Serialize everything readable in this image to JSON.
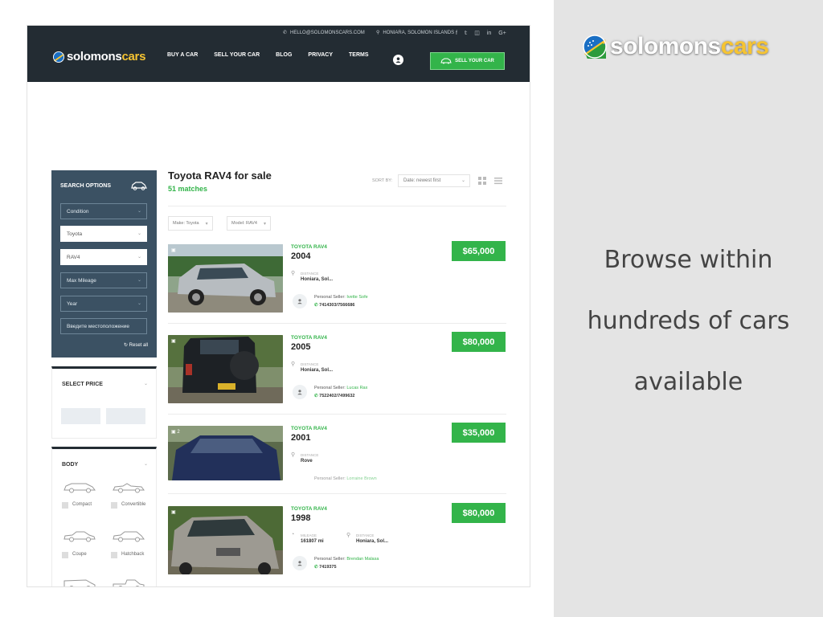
{
  "promo": {
    "brand_main": "solomons",
    "brand_accent": "cars",
    "lines": [
      "Browse within",
      "hundreds of cars",
      "available"
    ]
  },
  "topbar": {
    "email": "HELLO@SOLOMONSCARS.COM",
    "location": "HONIARA, SOLOMON ISLANDS",
    "social": [
      "f",
      "t",
      "ig",
      "in",
      "G+"
    ]
  },
  "header": {
    "brand_main": "solomons",
    "brand_accent": "cars",
    "nav": [
      "BUY A CAR",
      "SELL YOUR CAR",
      "BLOG",
      "PRIVACY",
      "TERMS"
    ],
    "sell_button": "SELL YOUR CAR"
  },
  "sidebar": {
    "search_title": "SEARCH OPTIONS",
    "filters": [
      "Condition",
      "Toyota",
      "RAV4",
      "Max Mileage",
      "Year",
      "Введите местоположение"
    ],
    "reset": "Reset all",
    "price_title": "SELECT PRICE",
    "body_title": "BODY",
    "body_types": [
      "Compact",
      "Convertible",
      "Coupe",
      "Hatchback"
    ]
  },
  "results": {
    "title": "Toyota RAV4 for sale",
    "count": "51 matches",
    "sort_label": "SORT BY:",
    "sort_value": "Date: newest first",
    "chips": [
      "Make: Toyota",
      "Model: RAV4"
    ],
    "listings": [
      {
        "model": "TOYOTA RAV4",
        "year": "2004",
        "price": "$65,000",
        "photo_count": "",
        "distance_label": "DISTANCE",
        "distance": "Honiara, Sol...",
        "seller_prefix": "Personal Seller:",
        "seller": "Ivette Sofe",
        "phone": "7414303/7566686"
      },
      {
        "model": "TOYOTA RAV4",
        "year": "2005",
        "price": "$80,000",
        "photo_count": "",
        "distance_label": "DISTANCE",
        "distance": "Honiara, Sol...",
        "seller_prefix": "Personal Seller:",
        "seller": "Lucas Rax",
        "phone": "7522402/7499632"
      },
      {
        "model": "TOYOTA RAV4",
        "year": "2001",
        "price": "$35,000",
        "photo_count": "2",
        "distance_label": "DISTANCE",
        "distance": "Rove",
        "seller_prefix": "Personal Seller:",
        "seller": "Lorraine Brown",
        "phone": ""
      },
      {
        "model": "TOYOTA RAV4",
        "year": "1998",
        "price": "$80,000",
        "photo_count": "",
        "mileage_label": "MILEAGE",
        "mileage": "161807 mi",
        "distance_label": "DISTANCE",
        "distance": "Honiara, Sol...",
        "seller_prefix": "Personal Seller:",
        "seller": "Brendan Malasa",
        "phone": "7419375"
      }
    ]
  },
  "colors": {
    "header_bg": "#232c33",
    "accent_green": "#33b44a",
    "search_panel": "#3b5163",
    "brand_yellow": "#f6c432"
  }
}
